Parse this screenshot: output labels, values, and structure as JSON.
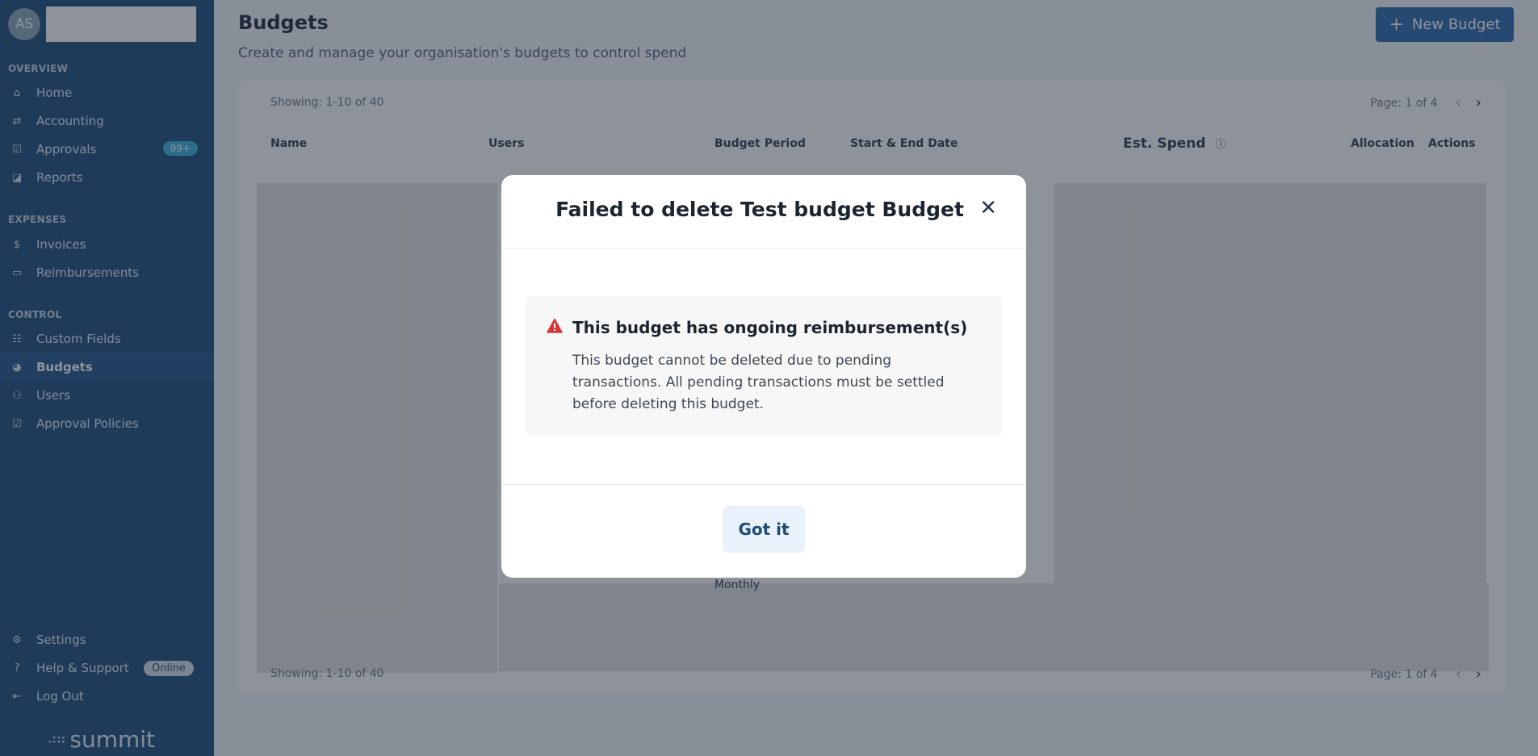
{
  "sidebar": {
    "avatar": "AS",
    "overview_label": "OVERVIEW",
    "expenses_label": "EXPENSES",
    "control_label": "CONTROL",
    "items": {
      "home": "Home",
      "accounting": "Accounting",
      "approvals": "Approvals",
      "approvals_badge": "99+",
      "reports": "Reports",
      "invoices": "Invoices",
      "reimbursements": "Reimbursements",
      "custom_fields": "Custom Fields",
      "budgets": "Budgets",
      "users": "Users",
      "approval_policies": "Approval Policies",
      "settings": "Settings",
      "help_support": "Help & Support",
      "online_badge": "Online",
      "log_out": "Log Out"
    },
    "logo_text": "summit"
  },
  "page": {
    "title": "Budgets",
    "subtitle": "Create and manage your organisation's budgets to control spend",
    "new_button": "New Budget"
  },
  "table": {
    "showing_top": "Showing: 1-10 of 40",
    "page_top": "Page: 1 of 4",
    "showing_bottom": "Showing: 1-10 of 40",
    "page_bottom": "Page: 1 of 4",
    "columns": {
      "name": "Name",
      "users": "Users",
      "budget_period": "Budget Period",
      "start_end": "Start & End Date",
      "est_spend": "Est. Spend",
      "allocation": "Allocation",
      "actions": "Actions"
    },
    "visible_period": "Monthly"
  },
  "modal": {
    "title": "Failed to delete Test budget Budget",
    "alert_heading": "This budget has ongoing reimbursement(s)",
    "alert_body": "This budget cannot be deleted due to pending transactions. All pending transactions must be settled before deleting this budget.",
    "confirm_button": "Got it"
  },
  "colors": {
    "sidebar": "#1f4f7d",
    "primary": "#2c6aa8",
    "badge": "#3bb3e0",
    "alert_red": "#d93636"
  }
}
